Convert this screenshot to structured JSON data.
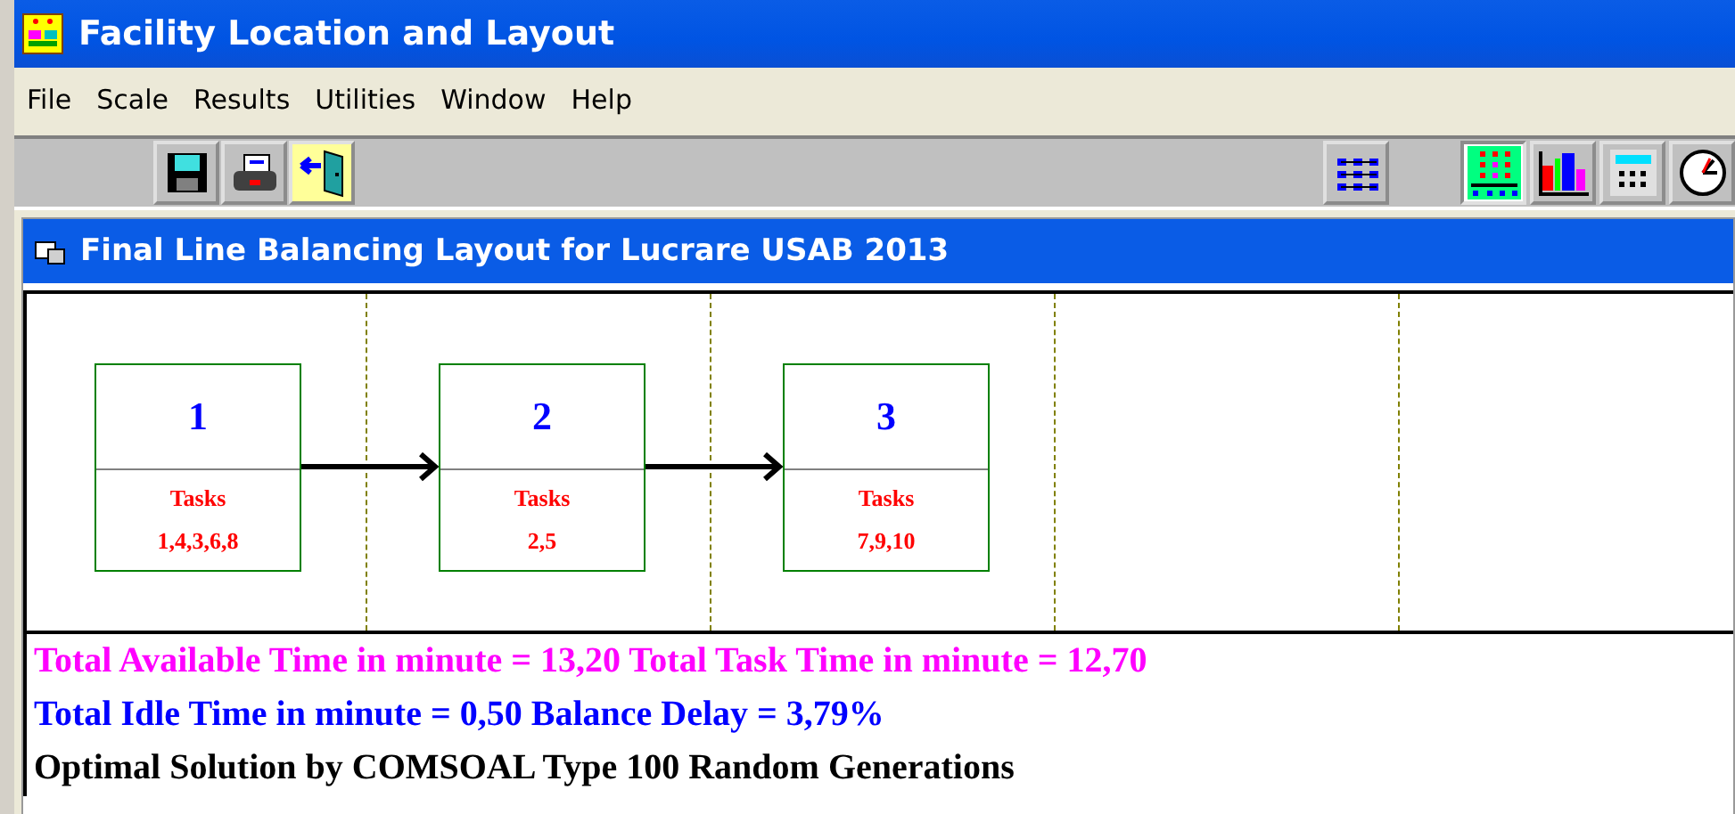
{
  "window": {
    "title": "Facility Location and Layout"
  },
  "menu": [
    "File",
    "Scale",
    "Results",
    "Utilities",
    "Window",
    "Help"
  ],
  "toolbar_left": [
    {
      "kind": "save"
    },
    {
      "kind": "print"
    },
    {
      "kind": "exit"
    }
  ],
  "toolbar_right": [
    {
      "kind": "network"
    },
    {
      "kind": "layout",
      "selected": true
    },
    {
      "kind": "barchart",
      "selected": false
    },
    {
      "kind": "calculator",
      "selected": false
    },
    {
      "kind": "clock",
      "selected": false
    }
  ],
  "child_window": {
    "title": "Final Line Balancing Layout for Lucrare USAB 2013"
  },
  "stations": [
    {
      "number": "1",
      "label": "Tasks",
      "tasks": "1,4,3,6,8"
    },
    {
      "number": "2",
      "label": "Tasks",
      "tasks": "2,5"
    },
    {
      "number": "3",
      "label": "Tasks",
      "tasks": "7,9,10"
    }
  ],
  "summary": [
    {
      "text": "Total Available Time in minute = 13,20  Total Task Time in minute = 12,70",
      "color": "#ff00ff"
    },
    {
      "text": "Total Idle Time in minute = 0,50  Balance Delay = 3,79%",
      "color": "#0000ff"
    },
    {
      "text": "Optimal Solution by COMSOAL Type 100 Random Generations",
      "color": "#000000"
    }
  ]
}
